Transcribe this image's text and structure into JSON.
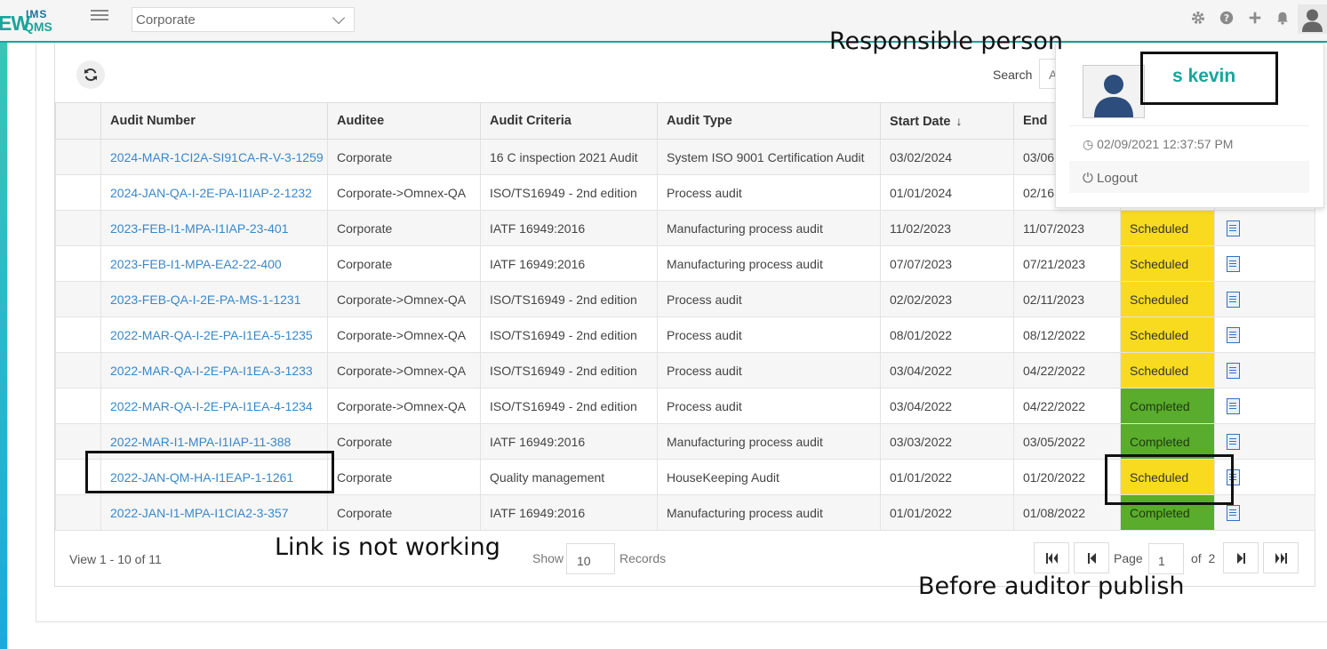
{
  "header": {
    "logo": {
      "ew": "EW",
      "ims": "IMS",
      "qms": "QMS"
    },
    "org_select_value": "Corporate",
    "icons": [
      "gear-icon",
      "help-icon",
      "plus-icon",
      "bell-icon",
      "user-avatar-icon"
    ]
  },
  "toolbar": {
    "search_label": "Search",
    "search_value": "A"
  },
  "table": {
    "columns": [
      "",
      "Audit Number",
      "Auditee",
      "Audit Criteria",
      "Audit Type",
      "Start Date",
      "End"
    ],
    "sort_indicator": "↓",
    "rows": [
      {
        "number": "2024-MAR-1CI2A-SI91CA-R-V-3-1259",
        "auditee": "Corporate",
        "criteria": "16 C inspection 2021 Audit",
        "type": "System ISO 9001 Certification Audit",
        "start": "03/02/2024",
        "end": "03/06",
        "status": ""
      },
      {
        "number": "2024-JAN-QA-I-2E-PA-I1IAP-2-1232",
        "auditee": "Corporate->Omnex-QA",
        "criteria": "ISO/TS16949 - 2nd edition",
        "type": "Process audit",
        "start": "01/01/2024",
        "end": "02/16",
        "status": ""
      },
      {
        "number": "2023-FEB-I1-MPA-I1IAP-23-401",
        "auditee": "Corporate",
        "criteria": "IATF 16949:2016",
        "type": "Manufacturing process audit",
        "start": "11/02/2023",
        "end": "11/07/2023",
        "status": "Scheduled"
      },
      {
        "number": "2023-FEB-I1-MPA-EA2-22-400",
        "auditee": "Corporate",
        "criteria": "IATF 16949:2016",
        "type": "Manufacturing process audit",
        "start": "07/07/2023",
        "end": "07/21/2023",
        "status": "Scheduled"
      },
      {
        "number": "2023-FEB-QA-I-2E-PA-MS-1-1231",
        "auditee": "Corporate->Omnex-QA",
        "criteria": "ISO/TS16949 - 2nd edition",
        "type": "Process audit",
        "start": "02/02/2023",
        "end": "02/11/2023",
        "status": "Scheduled"
      },
      {
        "number": "2022-MAR-QA-I-2E-PA-I1EA-5-1235",
        "auditee": "Corporate->Omnex-QA",
        "criteria": "ISO/TS16949 - 2nd edition",
        "type": "Process audit",
        "start": "08/01/2022",
        "end": "08/12/2022",
        "status": "Scheduled"
      },
      {
        "number": "2022-MAR-QA-I-2E-PA-I1EA-3-1233",
        "auditee": "Corporate->Omnex-QA",
        "criteria": "ISO/TS16949 - 2nd edition",
        "type": "Process audit",
        "start": "03/04/2022",
        "end": "04/22/2022",
        "status": "Scheduled"
      },
      {
        "number": "2022-MAR-QA-I-2E-PA-I1EA-4-1234",
        "auditee": "Corporate->Omnex-QA",
        "criteria": "ISO/TS16949 - 2nd edition",
        "type": "Process audit",
        "start": "03/04/2022",
        "end": "04/22/2022",
        "status": "Completed"
      },
      {
        "number": "2022-MAR-I1-MPA-I1IAP-11-388",
        "auditee": "Corporate",
        "criteria": "IATF 16949:2016",
        "type": "Manufacturing process audit",
        "start": "03/03/2022",
        "end": "03/05/2022",
        "status": "Completed"
      },
      {
        "number": "2022-JAN-QM-HA-I1EAP-1-1261",
        "auditee": "Corporate",
        "criteria": "Quality management",
        "type": "HouseKeeping Audit",
        "start": "01/01/2022",
        "end": "01/20/2022",
        "status": "Scheduled"
      },
      {
        "number": "2022-JAN-I1-MPA-I1CIA2-3-357",
        "auditee": "Corporate",
        "criteria": "IATF 16949:2016",
        "type": "Manufacturing process audit",
        "start": "01/01/2022",
        "end": "01/08/2022",
        "status": "Completed"
      }
    ],
    "status_colors": {
      "Scheduled": "#f8db1e",
      "Completed": "#5aac2c"
    }
  },
  "footer": {
    "view_info": "View 1 - 10 of 11",
    "show_label": "Show",
    "show_value": "10",
    "records_label": "Records",
    "page_label": "Page",
    "page_value": "1",
    "of_label": "of  2"
  },
  "user_menu": {
    "name": "s kevin",
    "login_time": "02/09/2021 12:37:57 PM",
    "logout_label": "Logout"
  },
  "annotations": {
    "responsible": "Responsible person",
    "link_broken": "Link is not working",
    "before_publish": "Before auditor publish"
  },
  "colors": {
    "accent": "#17a69a",
    "link": "#3a87c8"
  }
}
